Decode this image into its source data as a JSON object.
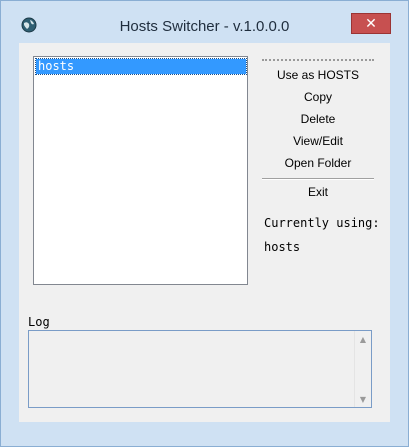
{
  "window": {
    "title": "Hosts Switcher - v.1.0.0.0",
    "close_glyph": "✕"
  },
  "hosts_list": {
    "items": [
      "hosts"
    ]
  },
  "menu": {
    "items": [
      "Use as HOSTS",
      "Copy",
      "Delete",
      "View/Edit",
      "Open Folder",
      "Exit"
    ]
  },
  "status": {
    "label": "Currently using:",
    "value": "hosts"
  },
  "log": {
    "label": "Log",
    "content": ""
  },
  "colors": {
    "frame": "#cfe1f3",
    "selection": "#3399ff",
    "close_button": "#c75050"
  }
}
